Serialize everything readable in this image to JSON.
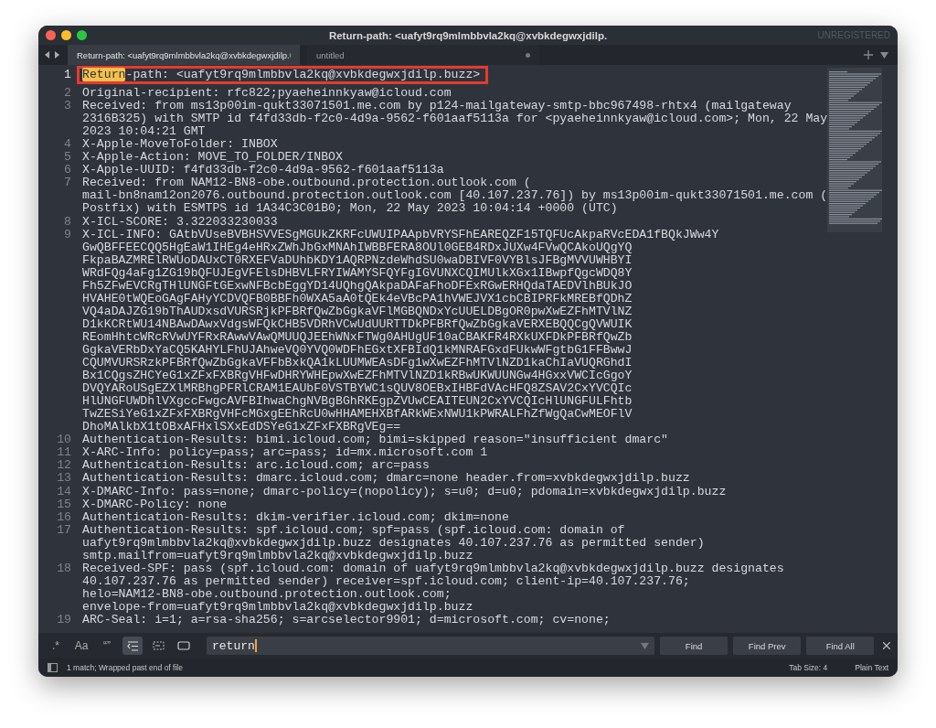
{
  "window": {
    "title": "Return-path: <uafyt9rq9mlmbbvla2kq@xvbkdegwxjdilp.",
    "badge": "UNREGISTERED"
  },
  "tabs": [
    {
      "label": "Return-path: <uafyt9rq9mlmbbvla2kq@xvbkdegwxjdilp.",
      "selected": true,
      "modified": true
    },
    {
      "label": "untitled",
      "selected": false,
      "modified": true
    }
  ],
  "lines": [
    {
      "number": "1",
      "current": true,
      "match": "Return",
      "rows": [
        "-path: <uafyt9rq9mlmbbvla2kq@xvbkdegwxjdilp.buzz>"
      ]
    },
    {
      "number": "2",
      "current": false,
      "rows": [
        "Original-recipient: rfc822;pyaeheinnkyaw@icloud.com"
      ]
    },
    {
      "number": "3",
      "current": false,
      "rows": [
        "Received: from ms13p00im-qukt33071501.me.com by p124-mailgateway-smtp-bbc967498-rhtx4 (mailgateway",
        "2316B325) with SMTP id f4fd33db-f2c0-4d9a-9562-f601aaf5113a for <pyaeheinnkyaw@icloud.com>; Mon, 22 May",
        "2023 10:04:21 GMT"
      ]
    },
    {
      "number": "4",
      "current": false,
      "rows": [
        "X-Apple-MoveToFolder: INBOX"
      ]
    },
    {
      "number": "5",
      "current": false,
      "rows": [
        "X-Apple-Action: MOVE_TO_FOLDER/INBOX"
      ]
    },
    {
      "number": "6",
      "current": false,
      "rows": [
        "X-Apple-UUID: f4fd33db-f2c0-4d9a-9562-f601aaf5113a"
      ]
    },
    {
      "number": "7",
      "current": false,
      "rows": [
        "Received: from NAM12-BN8-obe.outbound.protection.outlook.com (",
        "mail-bn8nam12on2076.outbound.protection.outlook.com [40.107.237.76]) by ms13p00im-qukt33071501.me.com (",
        "Postfix) with ESMTPS id 1A34C3C01B0; Mon, 22 May 2023 10:04:14 +0000 (UTC)"
      ]
    },
    {
      "number": "8",
      "current": false,
      "rows": [
        "X-ICL-SCORE: 3.322033230033"
      ]
    },
    {
      "number": "9",
      "current": false,
      "rows": [
        "X-ICL-INFO: GAtbVUseBVBHSVVESgMGUkZKRFcUWUIPAApbVRYSFhEAREQZF15TQFUcAkpaRVcEDA1fBQkJWw4Y",
        "GwQBFFEECQQ5HgEaW1IHEg4eHRxZWhJbGxMNAhIWBBFERA8OUl0GEB4RDxJUXw4FVwQCAkoUQgYQ",
        "FkpaBAZMRElRWUoDAUxCT0RXEFVaDUhbKDY1AQRPNzdeWhdSU0waDBIVF0VYBlsJFBgMVVUWHBYI",
        "WRdFQg4aFg1ZG19bQFUJEgVFElsDHBVLFRYIWAMYSFQYFgIGVUNXCQIMUlkXGx1IBwpfQgcWDQ8Y",
        "Fh5ZFwEVCRgTHlUNGFtGExwNFBcbEggYD14UQhgQAkpaDAFaFhoDFExRGwERHQdaTAEDVlhBUkJO",
        "HVAHE0tWQEoGAgFAHyYCDVQFB0BBFh0WXA5aA0tQEk4eVBcPA1hVWEJVX1cbCBIPRFkMREBfQDhZ",
        "VQ4aDAJZG19bThAUDxsdVURSRjkPFBRfQwZbGgkaVFlMGBQNDxYcUUELDBgOR0pwXwEZFhMTVlNZ",
        "D1kKCRtWU14NBAwDAwxVdgsWFQkCHB5VDRhVCwUdUURTTDkPFBRfQwZbGgkaVERXEBQQCgQVWUIK",
        "REomHhtcWRcRVwUYFRxRAwwVAwQMUUQJEEhWNxFTWg0AHUgUF10aCBAKFR4RXkUXFDkPFBRfQwZb",
        "GgkaVERbDxYaCQ5KAHYLFhUJAhweVQ0YVQ0WDFhEGxtXFBIdQ1kMNRAFGxdFUkwWFgtbG1FFBwwJ",
        "CQUMVURSRzkPFBRfQwZbGgkaVFFbBxkQA1kLUUMWEAsDFg1wXwEZFhMTVlNZD1kaChIaVUQRGhdI",
        "Bx1CQgsZHCYeG1xZFxFXBRgVHFwDHRYWHEpwXwEZFhMTVlNZD1kRBwUKWUUNGw4HGxxVWCIcGgoY",
        "DVQYARoUSgEZXlMRBhgPFRlCRAM1EAUbF0VSTBYWC1sQUV8OEBxIHBFdVAcHFQ8ZSAV2CxYVCQIc",
        "HlUNGFUWDhlVXgccFwgcAVFBIhwaChgNVBgBGhRKEgpZVUwCEAITEUN2CxYVCQIcHlUNGFULFhtb",
        "TwZESiYeG1xZFxFXBRgVHFcMGxgEEhRcU0wHHAMEHXBfARkWExNWU1kPWRALFhZfWgQaCwMEOFlV",
        "DhoMAlkbX1tOBxAFHxlSXxEdDSYeG1xZFxFXBRgVEg=="
      ]
    },
    {
      "number": "10",
      "current": false,
      "rows": [
        "Authentication-Results: bimi.icloud.com; bimi=skipped reason=\"insufficient dmarc\""
      ]
    },
    {
      "number": "11",
      "current": false,
      "rows": [
        "X-ARC-Info: policy=pass; arc=pass; id=mx.microsoft.com 1"
      ]
    },
    {
      "number": "12",
      "current": false,
      "rows": [
        "Authentication-Results: arc.icloud.com; arc=pass"
      ]
    },
    {
      "number": "13",
      "current": false,
      "rows": [
        "Authentication-Results: dmarc.icloud.com; dmarc=none header.from=xvbkdegwxjdilp.buzz"
      ]
    },
    {
      "number": "14",
      "current": false,
      "rows": [
        "X-DMARC-Info: pass=none; dmarc-policy=(nopolicy); s=u0; d=u0; pdomain=xvbkdegwxjdilp.buzz"
      ]
    },
    {
      "number": "15",
      "current": false,
      "rows": [
        "X-DMARC-Policy: none"
      ]
    },
    {
      "number": "16",
      "current": false,
      "rows": [
        "Authentication-Results: dkim-verifier.icloud.com; dkim=none"
      ]
    },
    {
      "number": "17",
      "current": false,
      "rows": [
        "Authentication-Results: spf.icloud.com; spf=pass (spf.icloud.com: domain of",
        "uafyt9rq9mlmbbvla2kq@xvbkdegwxjdilp.buzz designates 40.107.237.76 as permitted sender)",
        "smtp.mailfrom=uafyt9rq9mlmbbvla2kq@xvbkdegwxjdilp.buzz"
      ]
    },
    {
      "number": "18",
      "current": false,
      "rows": [
        "Received-SPF: pass (spf.icloud.com: domain of uafyt9rq9mlmbbvla2kq@xvbkdegwxjdilp.buzz designates",
        "40.107.237.76 as permitted sender) receiver=spf.icloud.com; client-ip=40.107.237.76;",
        "helo=NAM12-BN8-obe.outbound.protection.outlook.com;",
        "envelope-from=uafyt9rq9mlmbbvla2kq@xvbkdegwxjdilp.buzz"
      ]
    },
    {
      "number": "19",
      "current": false,
      "rows": [
        "ARC-Seal: i=1; a=rsa-sha256; s=arcselector9901; d=microsoft.com; cv=none;"
      ]
    }
  ],
  "find_bar": {
    "toggles": [
      {
        "kind": "regex",
        "label": ".*",
        "on": false
      },
      {
        "kind": "case",
        "label": "Aa",
        "on": false
      },
      {
        "kind": "word",
        "label": "“”",
        "on": false
      },
      {
        "kind": "wrap",
        "on": true
      },
      {
        "kind": "selection",
        "on": false
      },
      {
        "kind": "highlight",
        "on": false
      }
    ],
    "query": "return",
    "buttons": [
      "Find",
      "Find Prev",
      "Find All"
    ]
  },
  "status_bar": {
    "message": "1 match; Wrapped past end of file",
    "tab_size": "Tab Size: 4",
    "syntax": "Plain Text"
  }
}
